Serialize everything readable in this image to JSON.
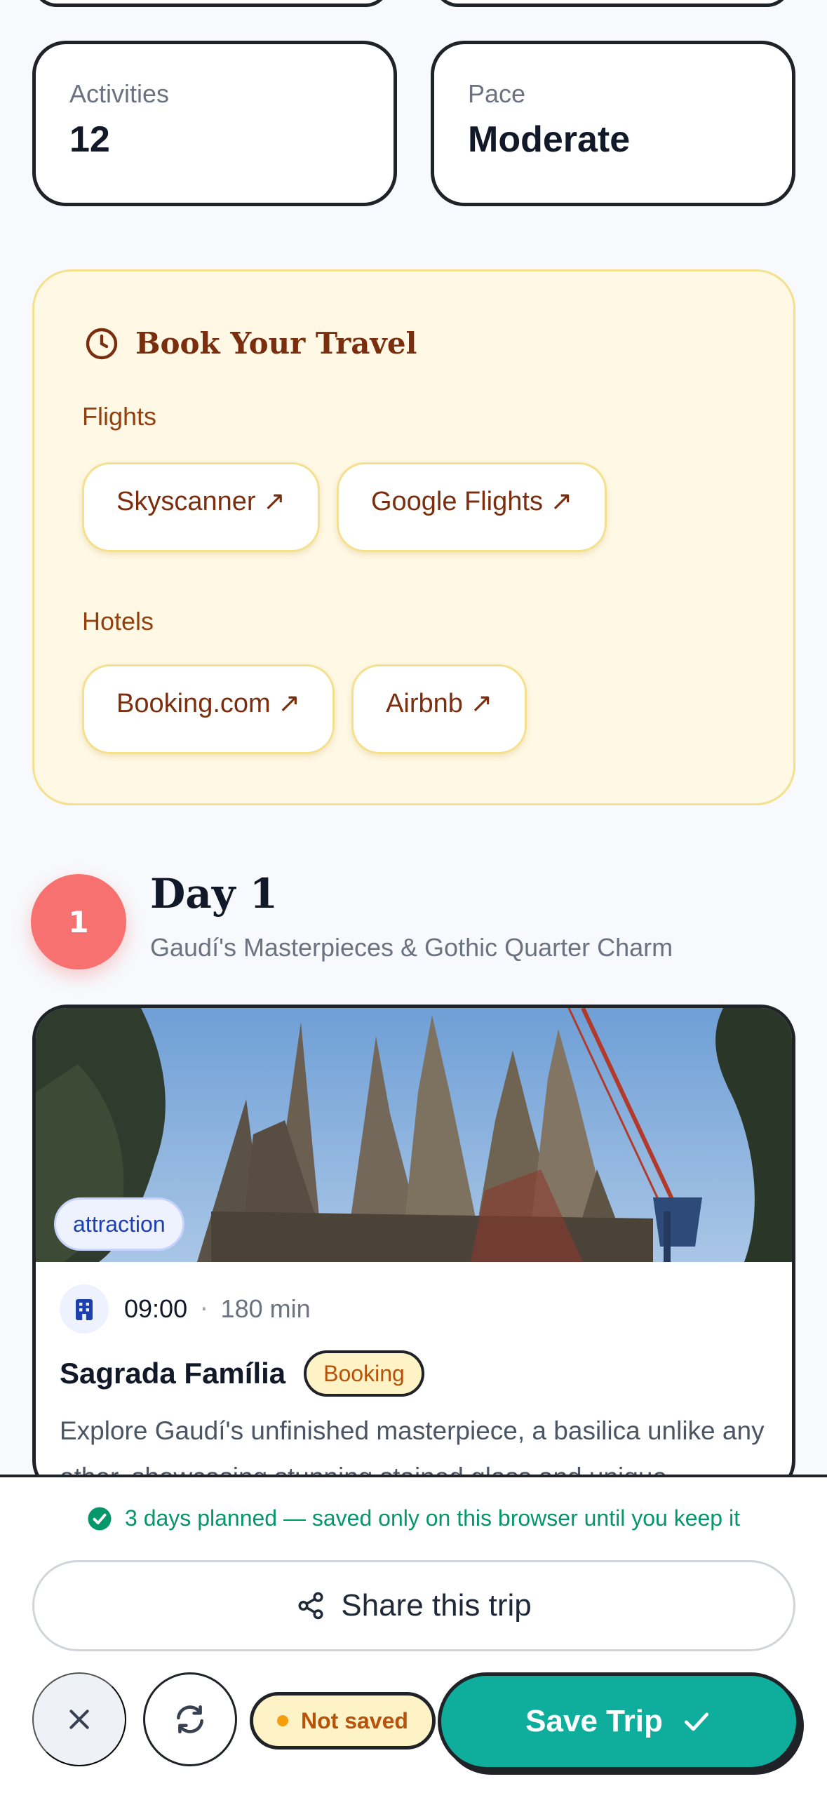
{
  "stats": [
    {
      "label": "Activities",
      "value": "12"
    },
    {
      "label": "Pace",
      "value": "Moderate"
    }
  ],
  "booking": {
    "title": "Book Your Travel",
    "icon": "clock-icon",
    "flights_label": "Flights",
    "flights": [
      "Skyscanner ↗",
      "Google Flights ↗"
    ],
    "hotels_label": "Hotels",
    "hotels": [
      "Booking.com ↗",
      "Airbnb ↗"
    ]
  },
  "day": {
    "number": "1",
    "title": "Day 1",
    "subtitle": "Gaudí's Masterpieces & Gothic Quarter Charm"
  },
  "activity": {
    "type": "attraction",
    "icon": "building-icon",
    "time": "09:00",
    "separator": "·",
    "duration": "180 min",
    "name": "Sagrada Família",
    "badge": "Booking",
    "description": "Explore Gaudí's unfinished masterpiece, a basilica unlike any other, showcasing stunning stained glass and unique"
  },
  "footer": {
    "status": "3 days planned — saved only on this browser until you keep it",
    "share_label": "Share this trip",
    "not_saved_label": "Not saved",
    "save_label": "Save Trip"
  },
  "colors": {
    "accent": "#0fae9c",
    "day_circle": "#f87171",
    "booking_bg": "#fef8e4",
    "status_green": "#059669"
  }
}
